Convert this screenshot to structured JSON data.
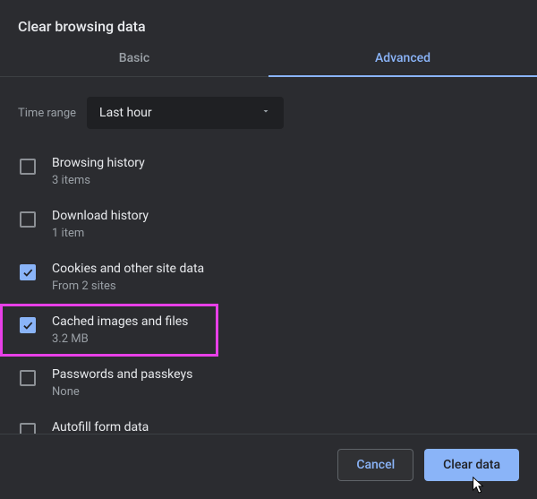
{
  "title": "Clear browsing data",
  "tabs": {
    "basic": "Basic",
    "advanced": "Advanced",
    "active": "advanced"
  },
  "time_range": {
    "label": "Time range",
    "value": "Last hour"
  },
  "items": [
    {
      "label": "Browsing history",
      "sub": "3 items",
      "checked": false
    },
    {
      "label": "Download history",
      "sub": "1 item",
      "checked": false
    },
    {
      "label": "Cookies and other site data",
      "sub": "From 2 sites",
      "checked": true
    },
    {
      "label": "Cached images and files",
      "sub": "3.2 MB",
      "checked": true,
      "highlighted": true
    },
    {
      "label": "Passwords and passkeys",
      "sub": "None",
      "checked": false
    },
    {
      "label": "Autofill form data",
      "sub": "",
      "checked": false
    }
  ],
  "buttons": {
    "cancel": "Cancel",
    "confirm": "Clear data"
  }
}
